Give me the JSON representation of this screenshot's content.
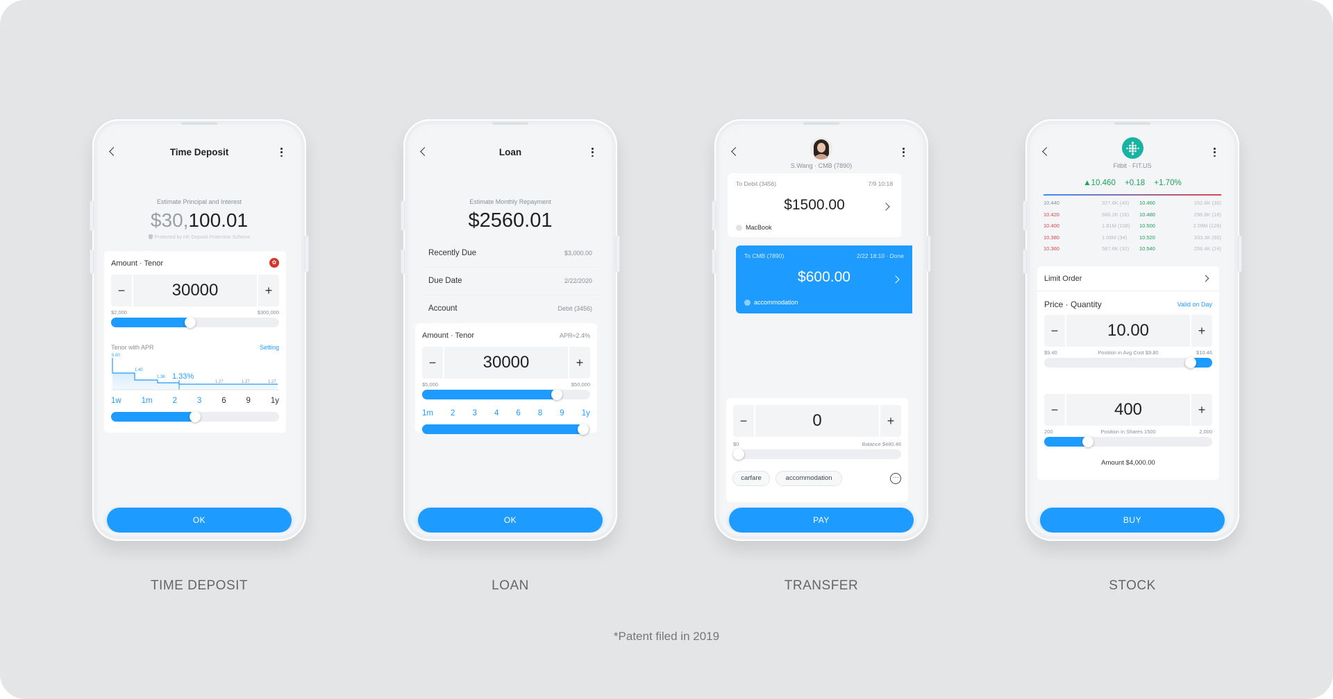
{
  "phones": {
    "deposit": {
      "title": "Time Deposit",
      "summary_label": "Estimate Principal and Interest",
      "amount_gray": "$30,",
      "amount_dark": "100.01",
      "protection_note": "Protected by HK Deposit Protection Scheme",
      "section_label": "Amount · Tenor",
      "amount_value": "30000",
      "range_min": "$2,000",
      "range_max": "$300,000",
      "amount_fraction": 0.47,
      "tenor_label": "Tenor with APR",
      "setting_link": "Setting",
      "chart_highlight": "1.33%",
      "chart_labels": [
        "5.00",
        "1.40",
        "1.36",
        "1.27",
        "1.27",
        "1.27"
      ],
      "tenors": [
        "1w",
        "1m",
        "2",
        "3",
        "6",
        "9",
        "1y"
      ],
      "tenor_fraction": 0.5,
      "button": "OK",
      "caption": "TIME DEPOSIT"
    },
    "loan": {
      "title": "Loan",
      "summary_label": "Estimate Monthly Repayment",
      "amount": "$2560.01",
      "rows": [
        {
          "key": "Recently Due",
          "value": "$3,000.00"
        },
        {
          "key": "Due Date",
          "value": "2/22/2020"
        },
        {
          "key": "Account",
          "value": "Debit (3456)"
        }
      ],
      "section_label": "Amount · Tenor",
      "apr": "APR≈2.4%",
      "amount_value": "30000",
      "range_min": "$5,000",
      "range_max": "$50,000",
      "amount_fraction": 0.8,
      "tenors": [
        "1m",
        "2",
        "3",
        "4",
        "6",
        "8",
        "9",
        "1y"
      ],
      "tenor_fraction": 0.96,
      "button": "OK",
      "caption": "LOAN"
    },
    "transfer": {
      "recipient": "S.Wang · CMB (7890)",
      "card1_from": "To Debit (3456)",
      "card1_time": "7/9 10:18",
      "card1_amount": "$1500.00",
      "card1_note": "MacBook",
      "card2_from": "To CMB (7890)",
      "card2_time": "2/22 18:10 · Done",
      "card2_amount": "$600.00",
      "card2_note": "accommodation",
      "amount_value": "0",
      "range_min": "$0",
      "balance": "Balance $480.46",
      "amount_fraction": 0.0,
      "chips": [
        "carfare",
        "accommodation"
      ],
      "button": "PAY",
      "caption": "TRANSFER"
    },
    "stock": {
      "ticker": "Fitbit · FIT.US",
      "price": "10.460",
      "change": "+0.18",
      "change_pct": "+1.70%",
      "order_book": [
        {
          "bid": "10.440",
          "bid_vol": "327.6K (40)",
          "ask": "10.460",
          "ask_vol": "152.6K (36)"
        },
        {
          "bid": "10.420",
          "bid_vol": "566.2K (16)",
          "ask": "10.480",
          "ask_vol": "296.8K (18)"
        },
        {
          "bid": "10.400",
          "bid_vol": "1.81M (108)",
          "ask": "10.500",
          "ask_vol": "2.09M (128)"
        },
        {
          "bid": "10.380",
          "bid_vol": "1.08M (34)",
          "ask": "10.520",
          "ask_vol": "333.3K (60)"
        },
        {
          "bid": "10.360",
          "bid_vol": "587.6K (32)",
          "ask": "10.540",
          "ask_vol": "256.4K (24)"
        }
      ],
      "order_type": "Limit Order",
      "section_label": "Price · Quantity",
      "valid_label": "Valid on Day",
      "price_value": "10.00",
      "price_min": "$9.40",
      "price_note": "Position in Avg Cost $9.80",
      "price_max": "$10.46",
      "price_fraction": 0.87,
      "qty_value": "400",
      "qty_min": "200",
      "qty_note": "Position in Shares 1500",
      "qty_max": "2,000",
      "qty_fraction": 0.26,
      "total": "Amount $4,000.00",
      "button": "BUY",
      "caption": "STOCK"
    }
  },
  "footnote": "*Patent filed in 2019",
  "colors": {
    "accent": "#1e9bff",
    "up": "#1aa35b",
    "down": "#e0454b",
    "background": "#e4e5e7"
  }
}
